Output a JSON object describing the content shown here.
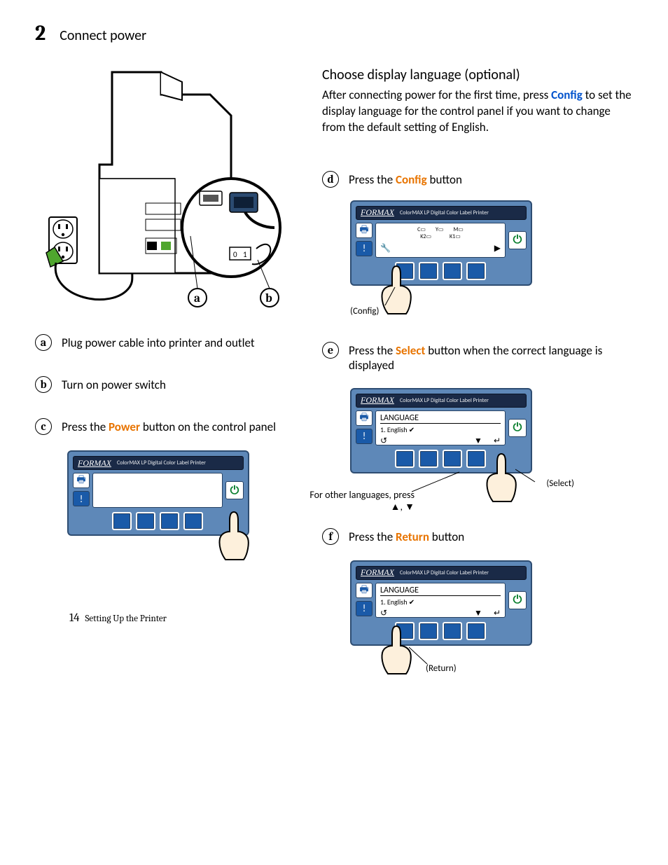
{
  "stepNumber": "2",
  "stepTitle": "Connect power",
  "left": {
    "a_label": "a",
    "b_label": "b",
    "steps": {
      "a": {
        "letter": "a",
        "text": "Plug power cable into printer and outlet"
      },
      "b": {
        "letter": "b",
        "text": "Turn on power switch"
      },
      "c": {
        "letter": "c",
        "prefix": "Press the ",
        "bold": "Power",
        "suffix": " button on the control panel"
      }
    }
  },
  "right": {
    "heading": "Choose display language (optional)",
    "para_parts": {
      "p1": "After connecting power for the first time, press ",
      "config": "Config",
      "p2": " to set the display language for the control panel if you want to change from the default setting of English."
    },
    "d": {
      "letter": "d",
      "prefix": "Press the ",
      "bold": "Config",
      "suffix": " button",
      "caption": "(Config)"
    },
    "e": {
      "letter": "e",
      "prefix": "Press the ",
      "bold": "Select",
      "suffix": " button when the correct language is displayed",
      "captionLeft": "For other languages, press",
      "captionLeft2": ",",
      "captionRight": "(Select)"
    },
    "f": {
      "letter": "f",
      "prefix": "Press the ",
      "bold": "Return",
      "suffix": " button",
      "caption": "(Return)"
    }
  },
  "panel": {
    "brand": "FORMAX",
    "tag": "ColorMAX LP Digital Color Label Printer",
    "inkLabels": {
      "c": "C",
      "y": "Y",
      "m": "M",
      "k2": "K2",
      "k1": "K1"
    },
    "langTitle": "LANGUAGE",
    "langItem": "1. English"
  },
  "footer": {
    "page": "14",
    "section": "Setting Up the Printer"
  }
}
